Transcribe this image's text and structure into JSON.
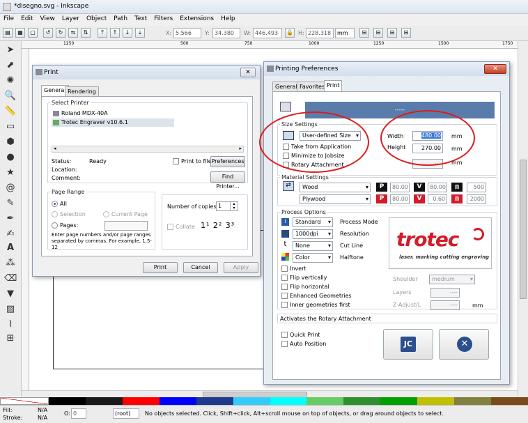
{
  "window": {
    "title": "*disegno.svg - Inkscape"
  },
  "menu": [
    "File",
    "Edit",
    "View",
    "Layer",
    "Object",
    "Path",
    "Text",
    "Filters",
    "Extensions",
    "Help"
  ],
  "toolbar": {
    "x_label": "X:",
    "x_value": "5.566",
    "y_label": "Y:",
    "y_value": "34.380",
    "w_label": "W:",
    "w_value": "446.493",
    "h_label": "H:",
    "h_value": "228.318",
    "unit": "mm"
  },
  "ruler": {
    "ticks": [
      "1250",
      "500",
      "750",
      "1000",
      "1250",
      "1500",
      "1750"
    ]
  },
  "print_dialog": {
    "title": "Print",
    "tabs": [
      "General",
      "Rendering"
    ],
    "select_printer_label": "Select Printer",
    "printers": [
      "Roland MDX-40A",
      "Trotec Engraver v10.6.1"
    ],
    "status_label": "Status:",
    "status_value": "Ready",
    "location_label": "Location:",
    "comment_label": "Comment:",
    "print_to_file": "Print to file",
    "preferences_btn": "Preferences",
    "find_printer_btn": "Find Printer...",
    "page_range_label": "Page Range",
    "range_all": "All",
    "range_selection": "Selection",
    "range_current": "Current Page",
    "range_pages": "Pages:",
    "range_hint": "Enter page numbers and/or page ranges separated by commas. For example, 1,5-12",
    "copies_label": "Number of copies:",
    "copies_value": "1",
    "collate_label": "Collate",
    "print_btn": "Print",
    "cancel_btn": "Cancel",
    "apply_btn": "Apply"
  },
  "prefs_dialog": {
    "title": "Printing Preferences",
    "tabs": [
      "General",
      "Favorites",
      "Print"
    ],
    "header_text": "-----",
    "size_settings_label": "Size Settings",
    "size_select": "User-defined Size",
    "take_from_app": "Take from Application",
    "minimize_jobsize": "Minimize to Jobsize",
    "rotary_attachment": "Rotary Attachment",
    "width_label": "Width",
    "width_value": "480.00",
    "width_unit": "mm",
    "height_label": "Height",
    "height_value": "270.00",
    "height_unit": "mm",
    "extra_unit": "mm",
    "extra_value": "----",
    "material_settings_label": "Material Settings",
    "material": "Wood",
    "material_sub": "Plywood",
    "row1": {
      "p": "80.00",
      "v": "80.00",
      "hz": "500"
    },
    "row2": {
      "p": "80.00",
      "v": "0.60",
      "hz": "2000"
    },
    "process_options_label": "Process Options",
    "process_mode_value": "Standard",
    "process_mode_label": "Process Mode",
    "resolution_value": "1000dpi",
    "resolution_label": "Resolution",
    "cutline_value": "None",
    "cutline_label": "Cut Line",
    "halftone_value": "Color",
    "halftone_label": "Halftone",
    "invert": "Invert",
    "flip_v": "Flip vertically",
    "flip_h": "Flip horizontal",
    "enhanced_geom": "Enhanced Geometries",
    "inner_geom": "Inner geometries first",
    "logo_text": "trotec",
    "logo_sub": "laser. marking cutting engraving",
    "shoulder_label": "Shoulder",
    "shoulder_value": "medium",
    "layers_label": "Layers",
    "layers_value": "----",
    "zadjust_label": "Z-Adjust/L",
    "zadjust_value": "----",
    "zadjust_unit": "mm",
    "rotary_footer": "Activates the Rotary Attachment",
    "quick_print": "Quick Print",
    "auto_position": "Auto Position"
  },
  "status": {
    "fill_label": "Fill:",
    "fill_value": "N/A",
    "stroke_label": "Stroke:",
    "stroke_value": "N/A",
    "opacity_label": "O:",
    "opacity_value": "0",
    "layer_value": "(root)",
    "message": "No objects selected. Click, Shift+click, Alt+scroll mouse on top of objects, or drag around objects to select."
  },
  "palette": [
    "#000000",
    "#1a1a1a",
    "#ff0000",
    "#0000ff",
    "#1e3a8a",
    "#33ccff",
    "#00ffff",
    "#66cc66",
    "#2f8f2f",
    "#00a000",
    "#c0c000",
    "#808040",
    "#7a4a1a"
  ],
  "colors": {
    "accent": "#e0191c",
    "trotec_red": "#d21c2a",
    "header_blue": "#5a7cab"
  }
}
